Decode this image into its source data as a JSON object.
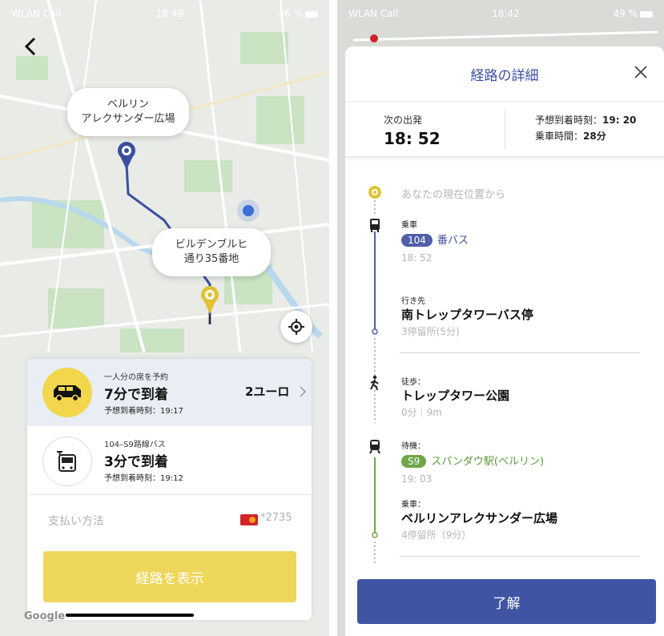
{
  "left_screen": {
    "status": {
      "carrier": "WLAN Call",
      "time": "18:49",
      "battery": "46 %"
    },
    "map": {
      "origin_bubble": [
        "ベルリン",
        "アレクサンダー広場"
      ],
      "destination_bubble": [
        "ビルデンブルヒ",
        "通り35番地"
      ],
      "route_color": "#3b4fa0",
      "destination_pin_color": "#e0c232",
      "google_label": "Google"
    },
    "ride_options": [
      {
        "icon": "car-icon",
        "caption": "一人分の席を予約",
        "arrival": "7分で到着",
        "eta": "予想到着時刻：19:17",
        "price": "2ユーロ"
      },
      {
        "icon": "bus-icon",
        "caption": "104–S9路線バス",
        "arrival": "3分で到着",
        "eta": "予想到着時刻：19:12"
      }
    ],
    "payment": {
      "label": "支払い方法",
      "card": "*2735"
    },
    "show_route_button": "経路を表示",
    "accent_color": "#eed65a"
  },
  "right_screen": {
    "status": {
      "carrier": "WLAN Call",
      "time": "18:42",
      "battery": "49 %"
    },
    "title": "経路の詳細",
    "next_departure_label": "次の出発",
    "next_departure_time": "18: 52",
    "eta_label": "予想到着時刻：",
    "eta_value": "19: 20",
    "ride_time_label": "乗車時間：",
    "ride_time_value": "28分",
    "steps": {
      "start": "あなたの現在位置から",
      "board_label": "乗車",
      "bus_number": "104",
      "bus_suffix": "番バス",
      "bus_time": "18: 52",
      "destination_label": "行き先",
      "destination_stop": "南トレップタワーバス停",
      "destination_info": "3停留所(5分)",
      "walk_label": "徒歩：",
      "walk_place": "トレップタワー公園",
      "walk_info": "0分｜9m",
      "wait_label": "待機：",
      "train_line": "S9",
      "train_station": "スパンダウ駅(ベルリン)",
      "train_time": "19: 03",
      "ride_label": "乗車：",
      "ride_destination": "ベルリンアレクサンダー広場",
      "ride_info": "4停留所（9分）"
    },
    "ok_button": "了解",
    "bus_color": "#4f5fa8",
    "train_color": "#6ea648"
  }
}
